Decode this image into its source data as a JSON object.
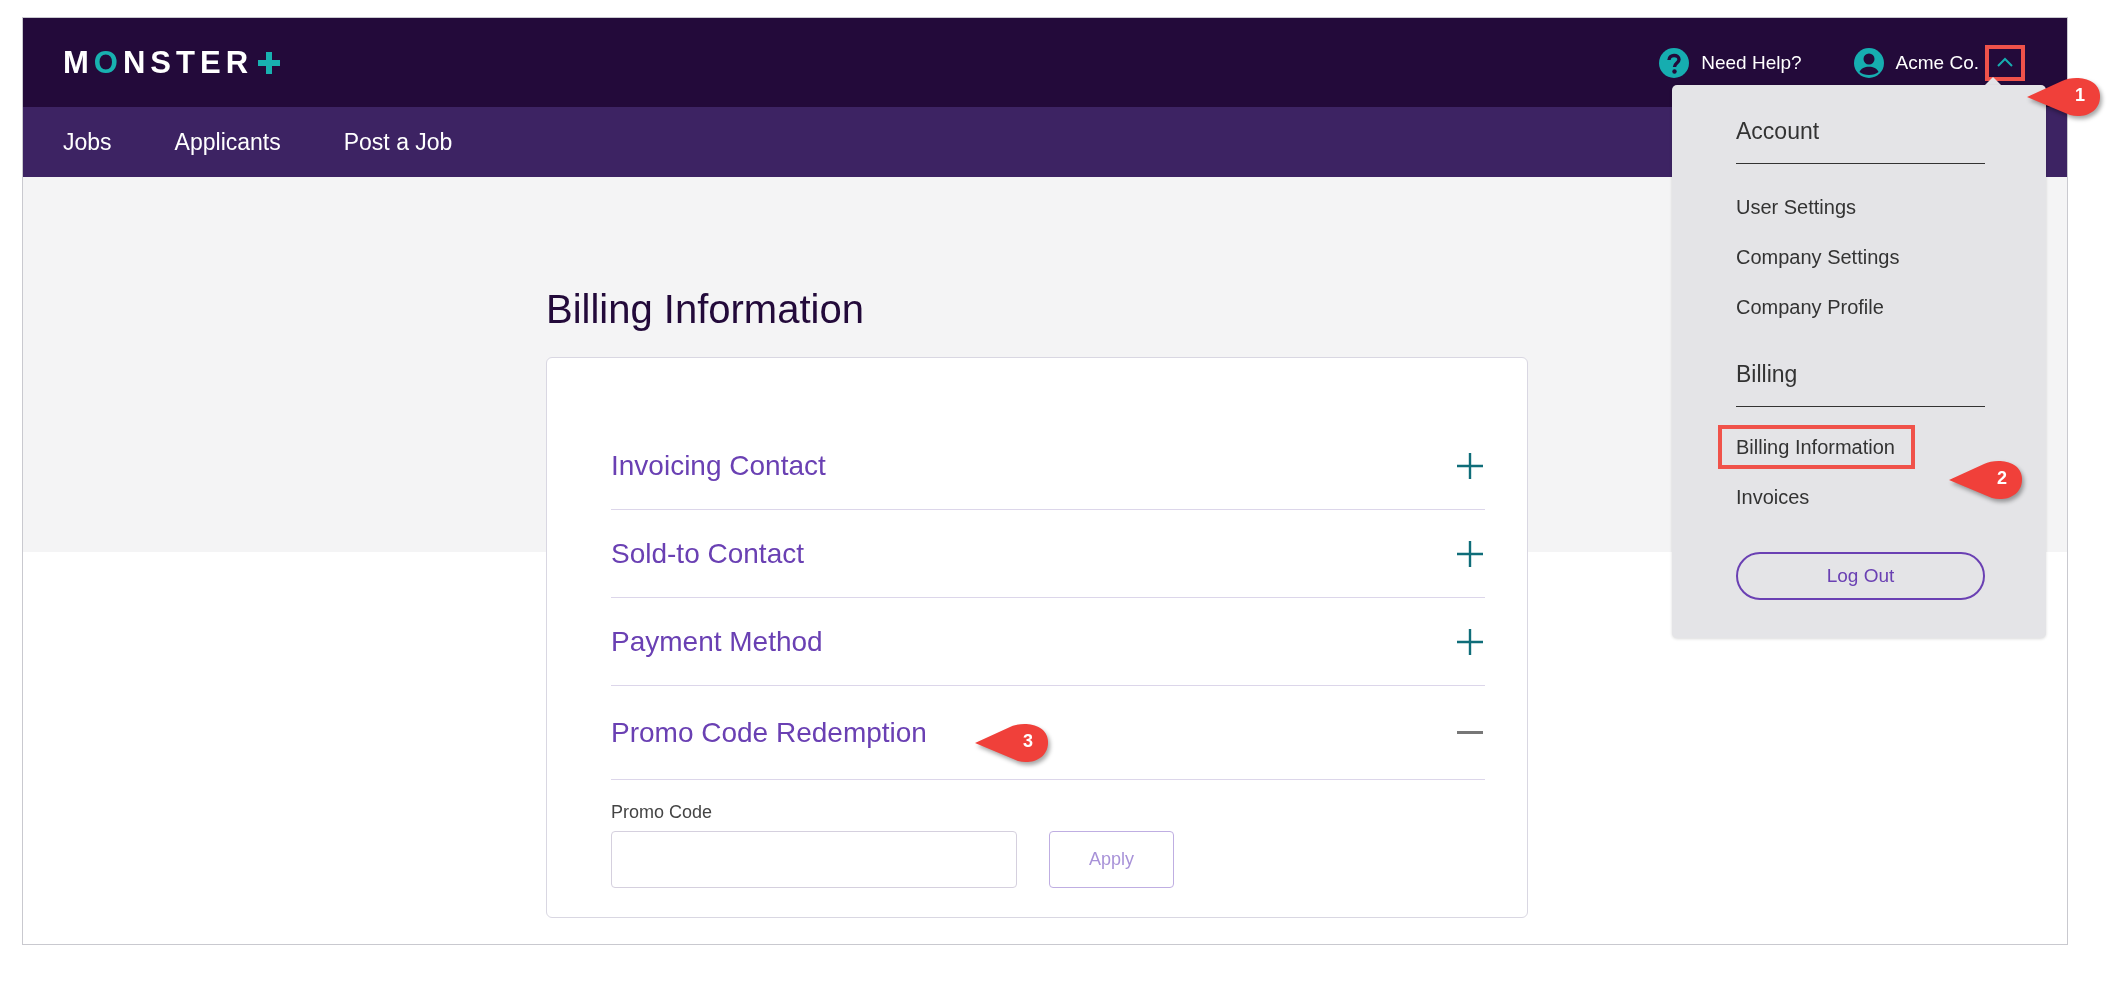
{
  "header": {
    "logo": "MONSTER",
    "help_link": "Need Help?",
    "account_name": "Acme Co.",
    "account_menu_expanded": true,
    "account_toggle_highlighted": true
  },
  "nav": [
    {
      "label": "Jobs"
    },
    {
      "label": "Applicants"
    },
    {
      "label": "Post a Job"
    }
  ],
  "page_title": "Billing Information",
  "sections": [
    {
      "title": "Invoicing Contact",
      "expanded": false
    },
    {
      "title": "Sold-to Contact",
      "expanded": false
    },
    {
      "title": "Payment Method",
      "expanded": false
    },
    {
      "title": "Promo Code Redemption",
      "expanded": true,
      "form": {
        "label": "Promo Code",
        "button": {
          "label": "Apply",
          "disabled": true
        }
      }
    }
  ],
  "account_menu": {
    "groups": [
      {
        "heading": "Account",
        "items": [
          {
            "label": "User Settings",
            "highlighted": false
          },
          {
            "label": "Company Settings",
            "highlighted": false
          },
          {
            "label": "Company Profile",
            "highlighted": false
          }
        ]
      },
      {
        "heading": "Billing",
        "items": [
          {
            "label": "Billing Information",
            "highlighted": true
          },
          {
            "label": "Invoices",
            "highlighted": false
          }
        ]
      }
    ],
    "logout_button": "Log Out"
  },
  "annotations": [
    {
      "label": "1"
    },
    {
      "label": "2"
    },
    {
      "label": "3"
    }
  ]
}
